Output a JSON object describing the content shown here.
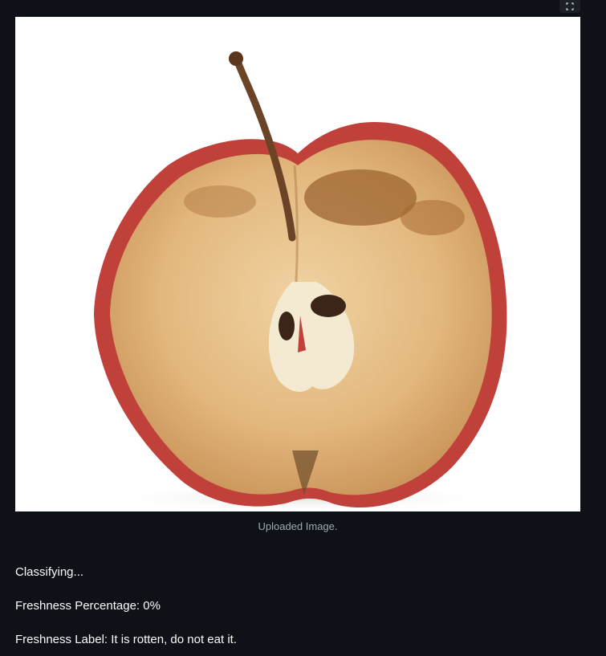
{
  "image": {
    "caption": "Uploaded Image.",
    "subject_icon": "rotten-apple-half"
  },
  "toolbar": {
    "fullscreen_icon": "fullscreen-icon"
  },
  "results": {
    "status_text": "Classifying...",
    "freshness_label_prefix": "Freshness Percentage: ",
    "freshness_value": "0%",
    "label_prefix": "Freshness Label: ",
    "label_value": "It is rotten, do not eat it."
  },
  "colors": {
    "background": "#0e1117",
    "text": "#fafafa",
    "caption": "#a3a8b4"
  }
}
